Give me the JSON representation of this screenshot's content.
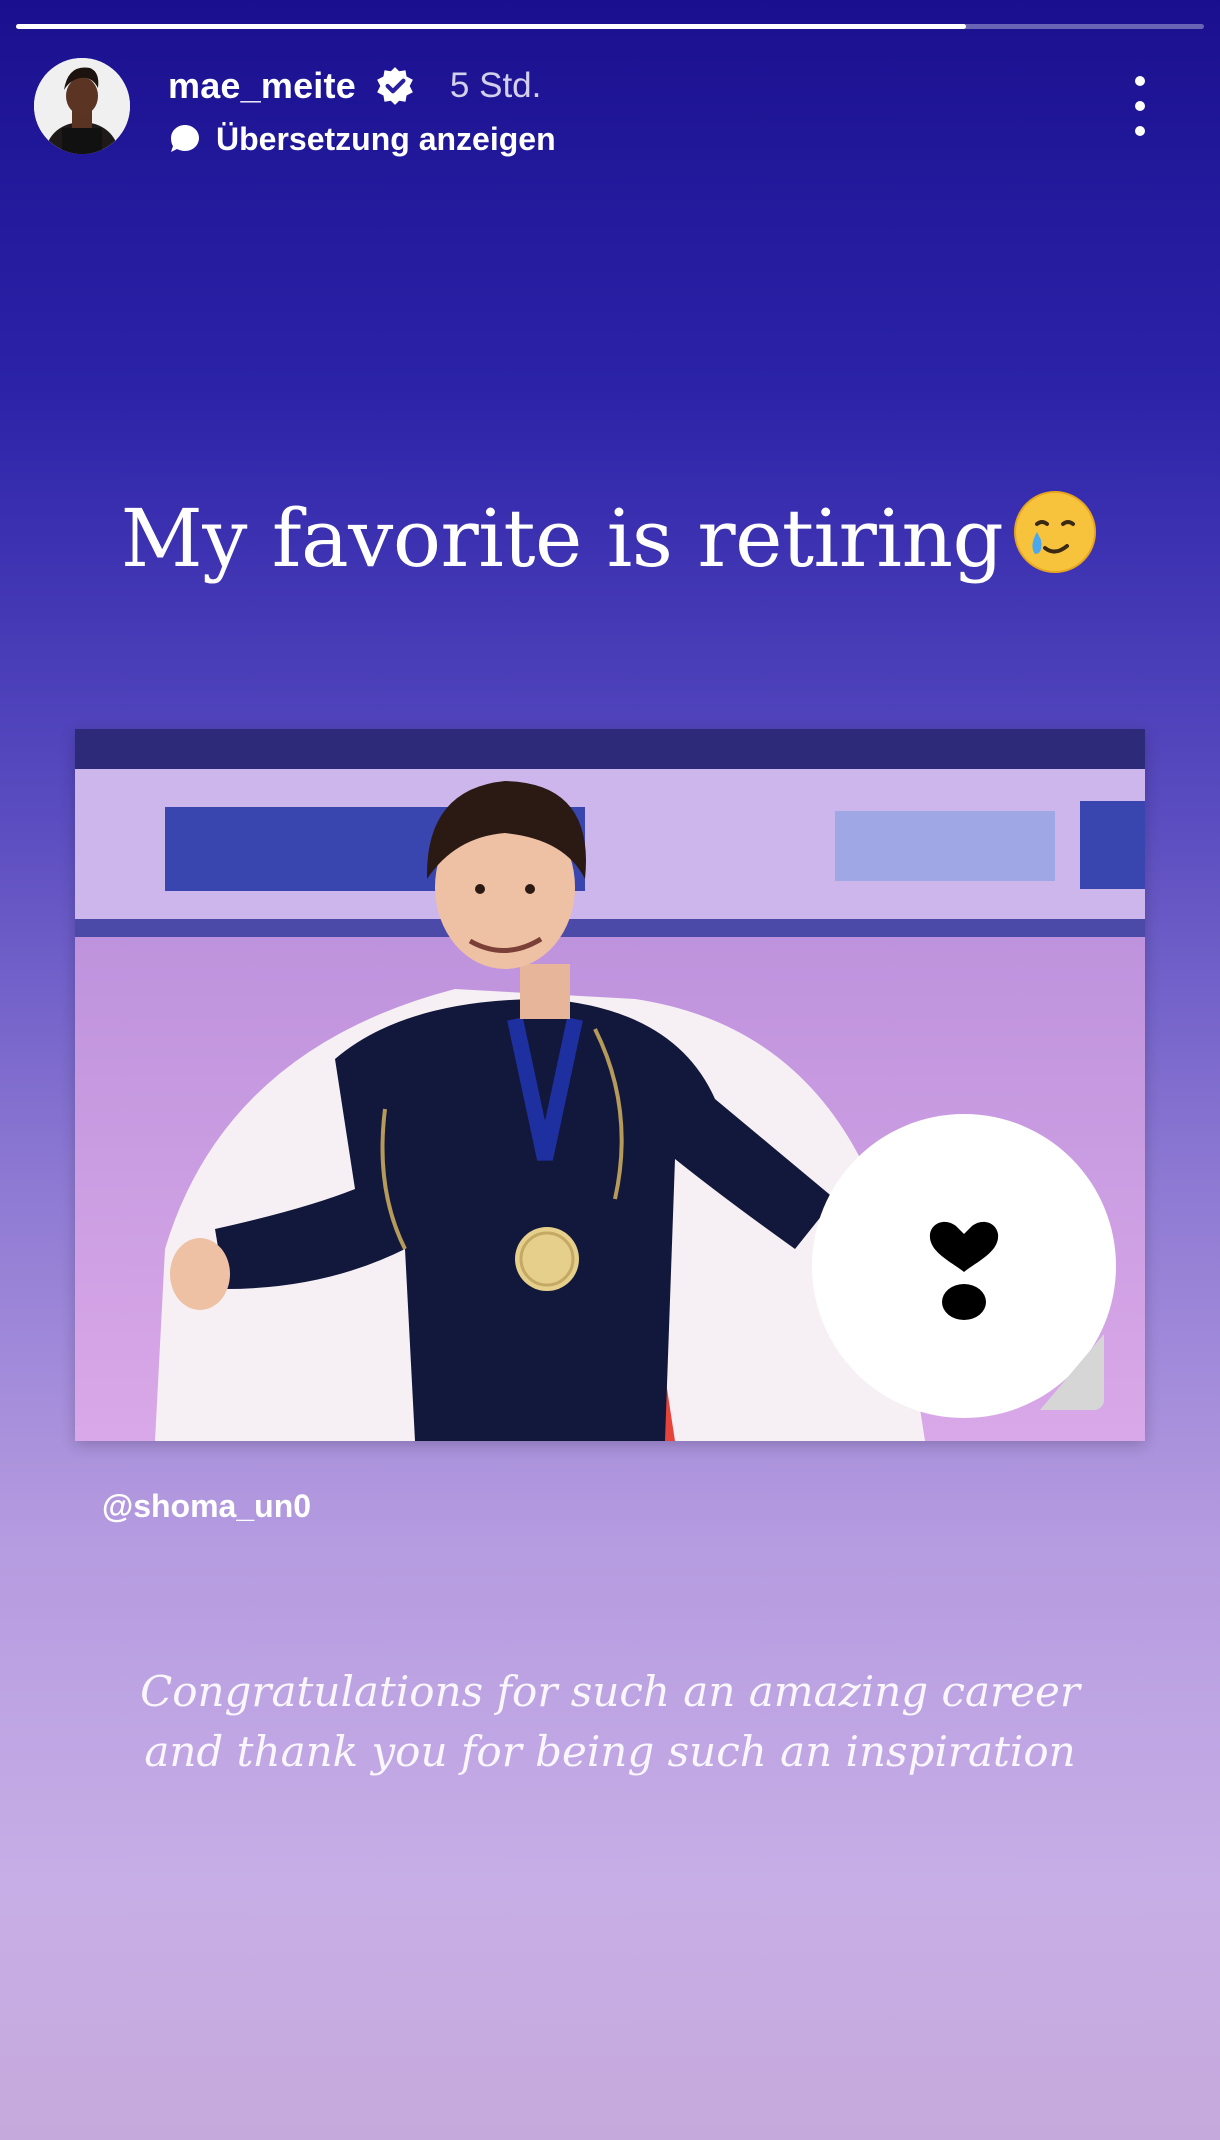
{
  "story": {
    "progress_fraction": 0.8,
    "user": {
      "username": "mae_meite",
      "verified": true,
      "time_ago": "5 Std."
    },
    "translate_label": "Übersetzung anzeigen",
    "headline": "My favorite is retiring",
    "headline_emoji": "smiling-face-with-tear-emoji",
    "mention": "@shoma_un0",
    "caption_line1": "Congratulations for such an amazing career",
    "caption_line2": "and thank you for being such an inspiration"
  },
  "colors": {
    "gradient_top": "#1a108f",
    "gradient_bottom": "#c6a9dc",
    "text": "#ffffff",
    "sticker_bg": "#ffffff"
  },
  "icons": {
    "verified": "verified-badge-icon",
    "translate": "chat-bubble-icon",
    "more": "more-vertical-icon",
    "sticker": "heart-drop-sticker-icon"
  }
}
